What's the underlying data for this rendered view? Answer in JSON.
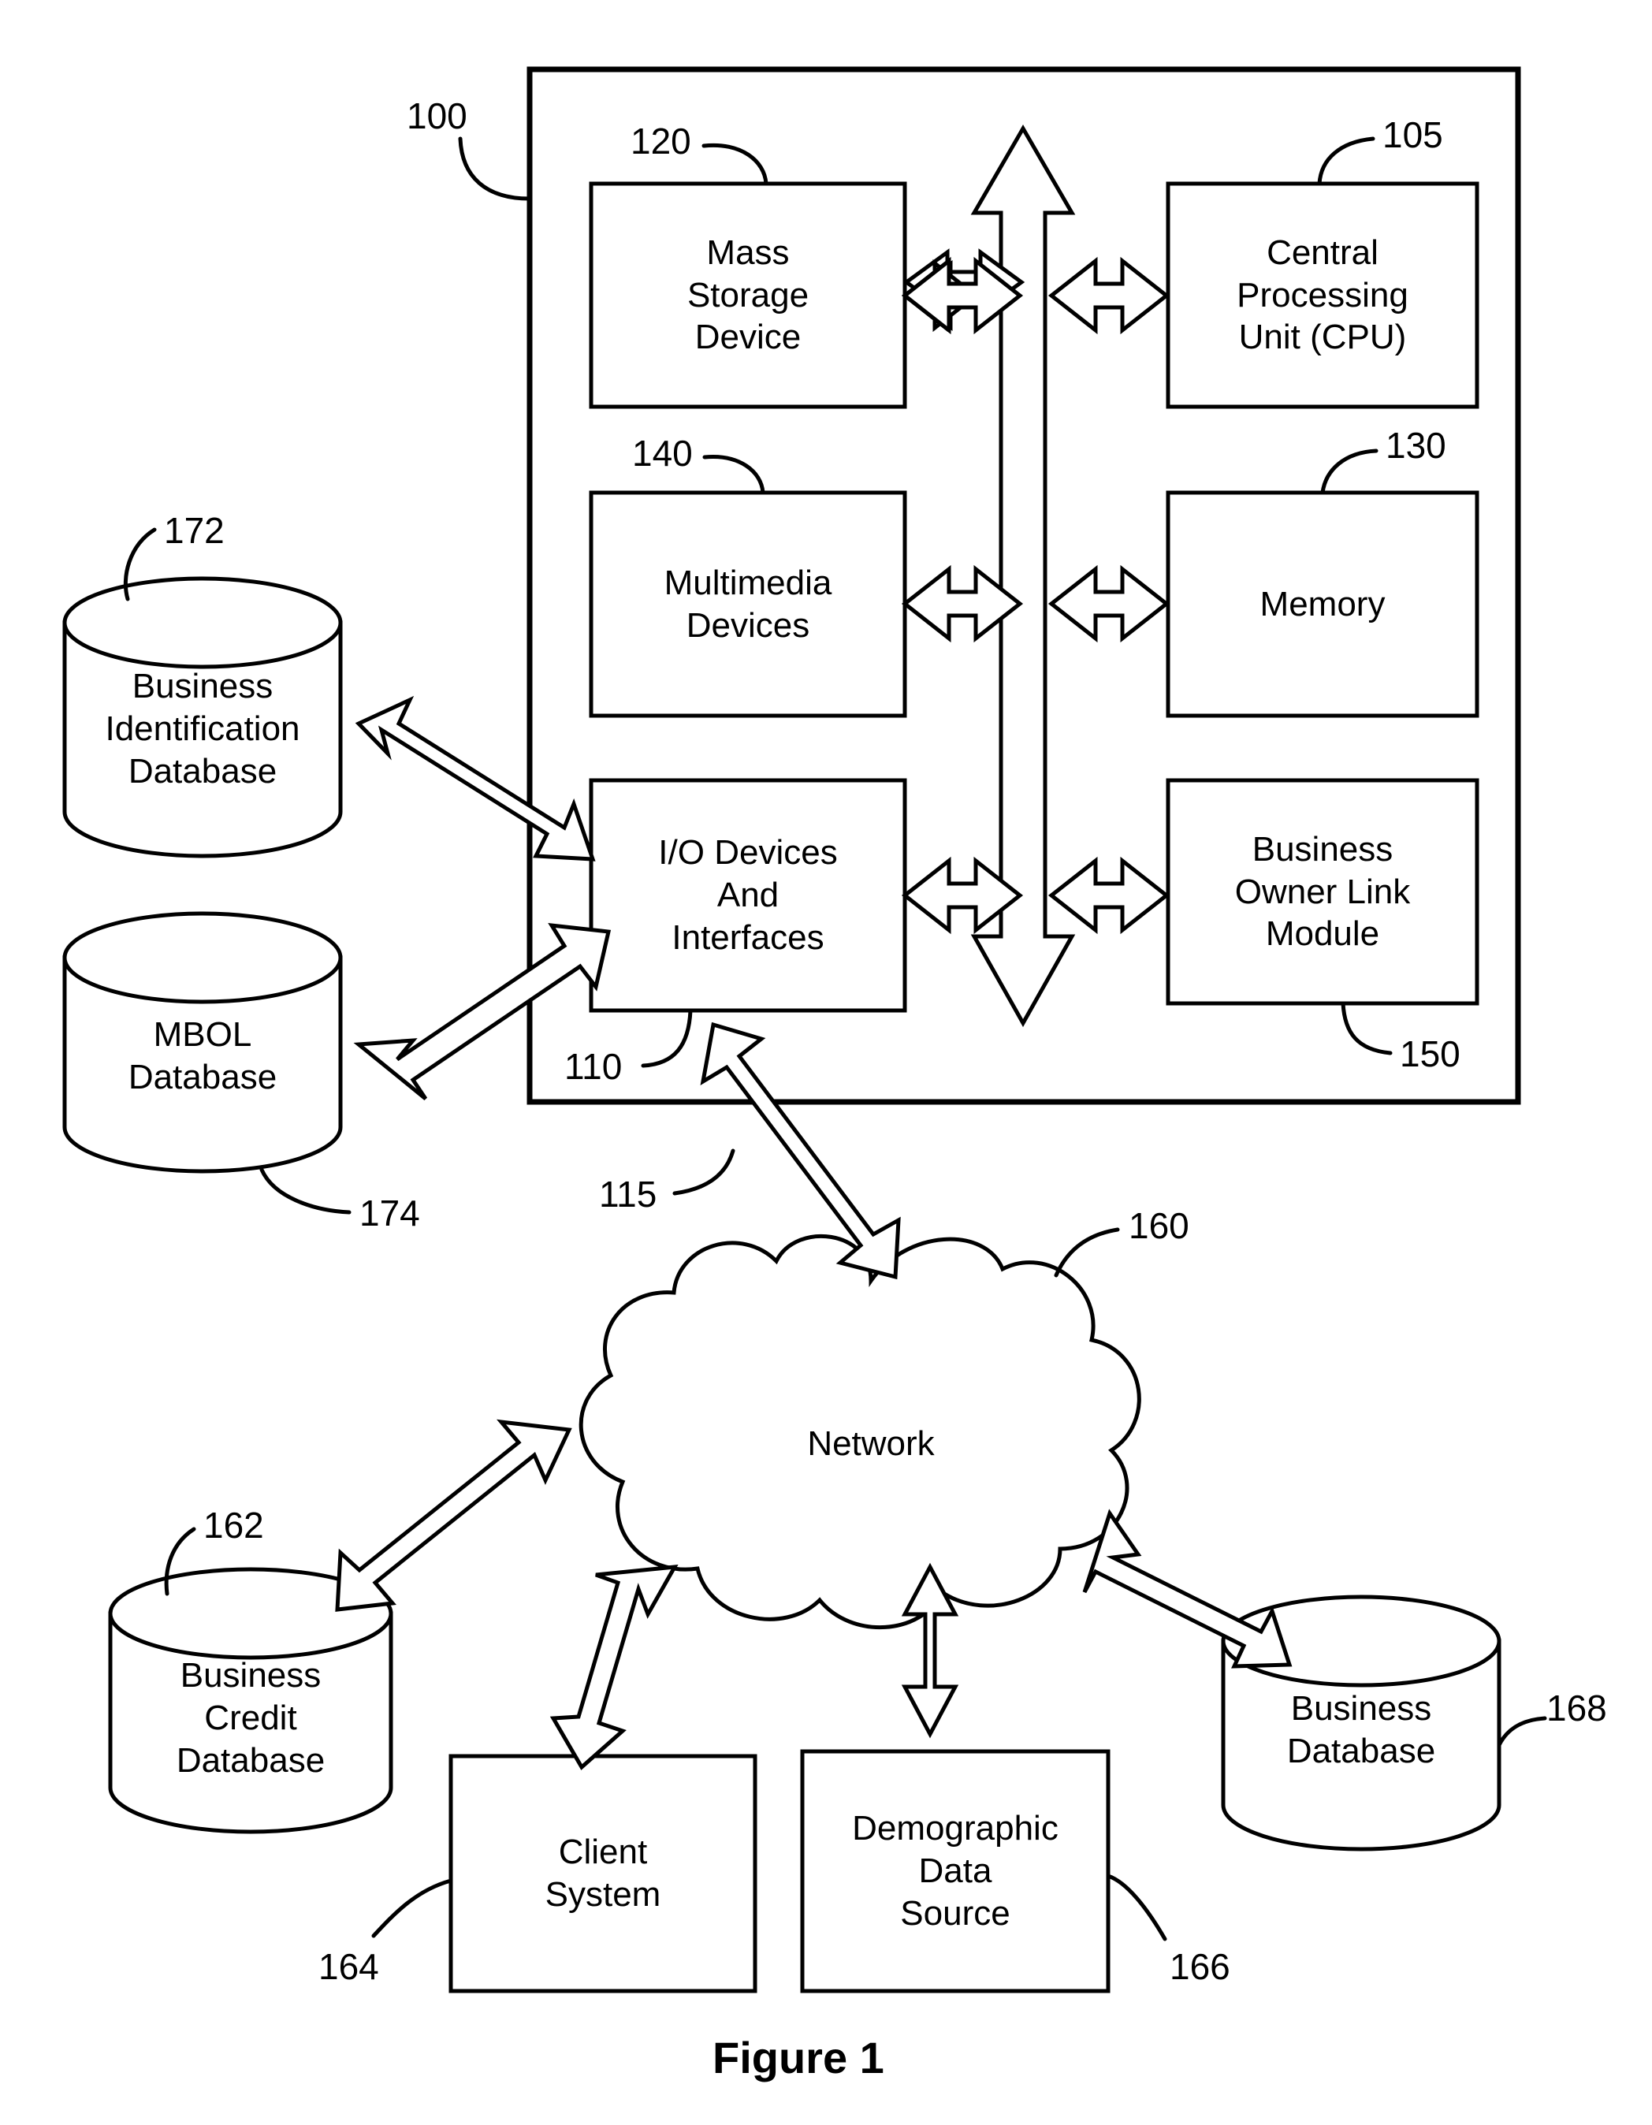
{
  "figure": {
    "caption": "Figure 1",
    "system_ref": "100"
  },
  "computing_system": {
    "ref": "100",
    "blocks": [
      {
        "id": "mass-storage-device",
        "label": "Mass\nStorage\nDevice",
        "ref": "120"
      },
      {
        "id": "central-processing-unit",
        "label": "Central\nProcessing\nUnit (CPU)",
        "ref": "105"
      },
      {
        "id": "multimedia-devices",
        "label": "Multimedia\nDevices",
        "ref": "140"
      },
      {
        "id": "memory",
        "label": "Memory",
        "ref": "130"
      },
      {
        "id": "io-devices-and-interfaces",
        "label": "I/O Devices\nAnd\nInterfaces",
        "ref": "110"
      },
      {
        "id": "business-owner-link-module",
        "label": "Business\nOwner Link\nModule",
        "ref": "150"
      }
    ],
    "bus": {
      "id": "system-bus",
      "label": ""
    }
  },
  "external": {
    "databases_left": [
      {
        "id": "business-identification-database",
        "label": "Business\nIdentification\nDatabase",
        "ref": "172"
      },
      {
        "id": "mbol-database",
        "label": "MBOL\nDatabase",
        "ref": "174"
      }
    ],
    "network": {
      "id": "network-cloud",
      "label": "Network",
      "ref": "160"
    },
    "network_link_ref": "115",
    "nodes_bottom": [
      {
        "id": "business-credit-database",
        "label": "Business\nCredit\nDatabase",
        "ref": "162"
      },
      {
        "id": "client-system",
        "label": "Client\nSystem",
        "ref": "164"
      },
      {
        "id": "demographic-data-source",
        "label": "Demographic\nData\nSource",
        "ref": "166"
      },
      {
        "id": "business-database",
        "label": "Business\nDatabase",
        "ref": "168"
      }
    ]
  },
  "colors": {
    "ink": "#000000",
    "paper": "#ffffff"
  }
}
